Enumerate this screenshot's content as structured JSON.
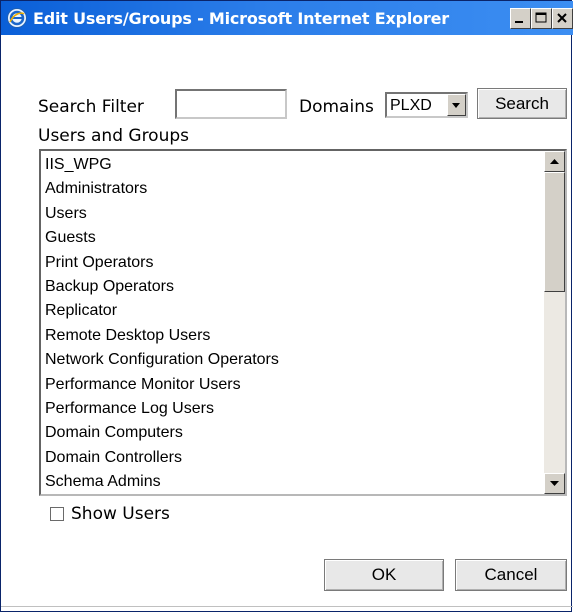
{
  "window": {
    "title": "Edit Users/Groups - Microsoft Internet Explorer",
    "icon": "ie-icon",
    "controls": [
      "minimize-icon",
      "maximize-icon",
      "close-icon"
    ]
  },
  "filter": {
    "search_filter_label": "Search Filter",
    "search_filter_value": "",
    "domains_label": "Domains",
    "domain_selected": "PLXD",
    "search_button": "Search"
  },
  "list": {
    "label": "Users and Groups",
    "items": [
      "IIS_WPG",
      "Administrators",
      "Users",
      "Guests",
      "Print Operators",
      "Backup Operators",
      "Replicator",
      "Remote Desktop Users",
      "Network Configuration Operators",
      "Performance Monitor Users",
      "Performance Log Users",
      "Domain Computers",
      "Domain Controllers",
      "Schema Admins"
    ]
  },
  "options": {
    "show_users_label": "Show Users",
    "show_users_checked": false
  },
  "actions": {
    "ok_label": "OK",
    "cancel_label": "Cancel"
  },
  "colors": {
    "titlebar": "#0a5fd8",
    "button_face": "#e8e8e8"
  }
}
